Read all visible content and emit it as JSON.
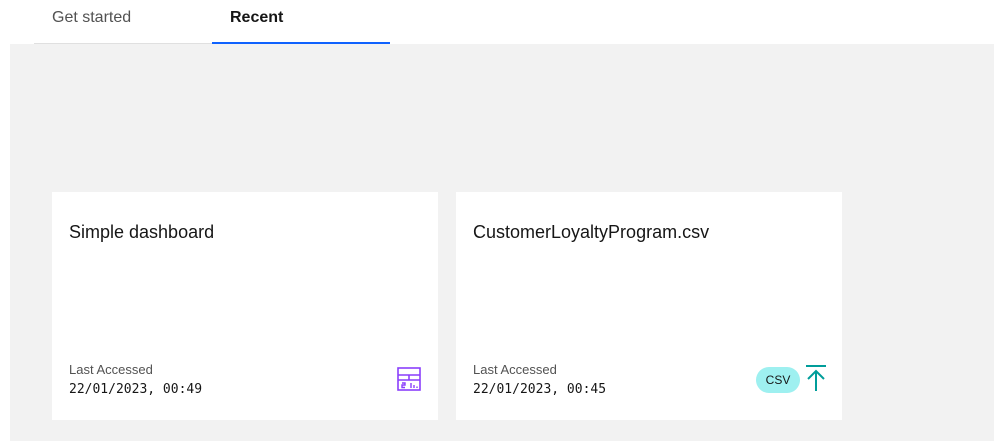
{
  "tabs": [
    {
      "label": "Get started",
      "active": false
    },
    {
      "label": "Recent",
      "active": true
    }
  ],
  "cards": [
    {
      "title": "Simple dashboard",
      "meta_label": "Last Accessed",
      "meta_date": "22/01/2023, 00:49",
      "icon": "dashboard-icon",
      "icon_color": "#8a3ffc"
    },
    {
      "title": "CustomerLoyaltyProgram.csv",
      "meta_label": "Last Accessed",
      "meta_date": "22/01/2023, 00:45",
      "badge": "CSV",
      "icon": "upload-icon",
      "icon_color": "#009d9a"
    }
  ],
  "colors": {
    "accent": "#0f62fe",
    "badge_bg": "#9ef0f0"
  }
}
